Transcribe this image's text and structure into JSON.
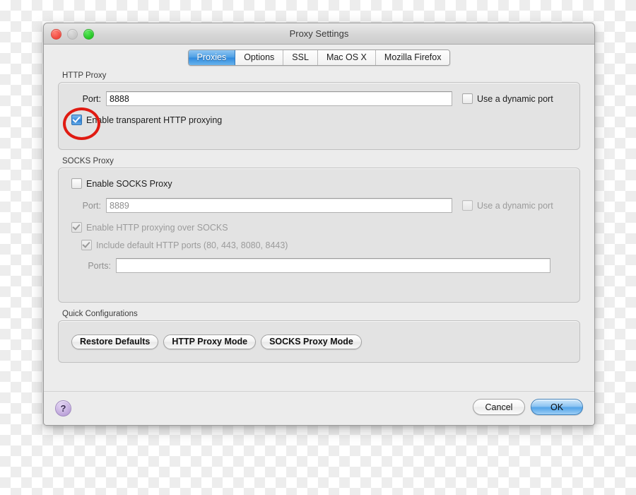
{
  "window": {
    "title": "Proxy Settings",
    "traffic_lights": [
      {
        "name": "close",
        "color": "#f04a40"
      },
      {
        "name": "minimize",
        "color": "#c6c6c6"
      },
      {
        "name": "zoom",
        "color": "#24c524"
      }
    ]
  },
  "tabs": [
    {
      "label": "Proxies",
      "active": true
    },
    {
      "label": "Options",
      "active": false
    },
    {
      "label": "SSL",
      "active": false
    },
    {
      "label": "Mac OS X",
      "active": false
    },
    {
      "label": "Mozilla Firefox",
      "active": false
    }
  ],
  "http_proxy": {
    "group_label": "HTTP Proxy",
    "port_label": "Port:",
    "port_value": "8888",
    "dynamic_port_label": "Use a dynamic port",
    "dynamic_port_checked": false,
    "transparent_label": "Enable transparent HTTP proxying",
    "transparent_checked": true
  },
  "socks_proxy": {
    "group_label": "SOCKS Proxy",
    "enable_label": "Enable SOCKS Proxy",
    "enable_checked": false,
    "port_label": "Port:",
    "port_value": "8889",
    "dynamic_port_label": "Use a dynamic port",
    "dynamic_port_checked": false,
    "http_over_socks_label": "Enable HTTP proxying over SOCKS",
    "http_over_socks_checked": true,
    "default_ports_label": "Include default HTTP ports (80, 443, 8080, 8443)",
    "default_ports_checked": true,
    "ports_label": "Ports:",
    "ports_value": ""
  },
  "quick_configurations": {
    "group_label": "Quick Configurations",
    "buttons": [
      {
        "label": "Restore Defaults"
      },
      {
        "label": "HTTP Proxy Mode"
      },
      {
        "label": "SOCKS Proxy Mode"
      }
    ]
  },
  "footer": {
    "help_label": "?",
    "cancel_label": "Cancel",
    "ok_label": "OK"
  },
  "annotation": {
    "type": "red-ellipse-highlight",
    "target": "Enable transparent HTTP proxying checkbox",
    "color": "#e01b12"
  }
}
